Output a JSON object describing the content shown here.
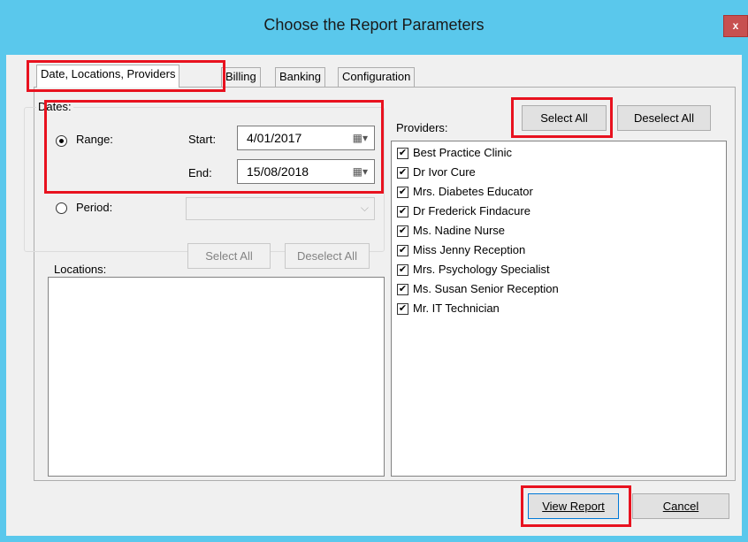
{
  "window": {
    "title": "Choose the Report Parameters",
    "close_label": "x"
  },
  "tabs": [
    {
      "label": "Date, Locations, Providers",
      "active": true
    },
    {
      "label": "Billing",
      "active": false
    },
    {
      "label": "Banking",
      "active": false
    },
    {
      "label": "Configuration",
      "active": false
    }
  ],
  "dates": {
    "group_label": "Dates:",
    "range_label": "Range:",
    "start_label": "Start:",
    "start_value": "4/01/2017",
    "end_label": "End:",
    "end_value": "15/08/2018",
    "period_label": "Period:",
    "period_value": "",
    "selected": "range"
  },
  "locations": {
    "label": "Locations:",
    "select_all": "Select All",
    "deselect_all": "Deselect All",
    "items": []
  },
  "providers": {
    "label": "Providers:",
    "select_all": "Select All",
    "deselect_all": "Deselect All",
    "items": [
      "Best Practice Clinic",
      "Dr Ivor Cure",
      "Mrs. Diabetes Educator",
      "Dr Frederick Findacure",
      "Ms. Nadine Nurse",
      "Miss Jenny Reception",
      "Mrs. Psychology Specialist",
      "Ms.  Susan Senior Reception",
      "Mr. IT Technician"
    ],
    "check_mark": "✔"
  },
  "footer": {
    "view_report": "View Report",
    "cancel": "Cancel"
  },
  "colors": {
    "highlight": "#e8121f",
    "titlebar": "#5ac8ec",
    "close": "#c75050"
  }
}
